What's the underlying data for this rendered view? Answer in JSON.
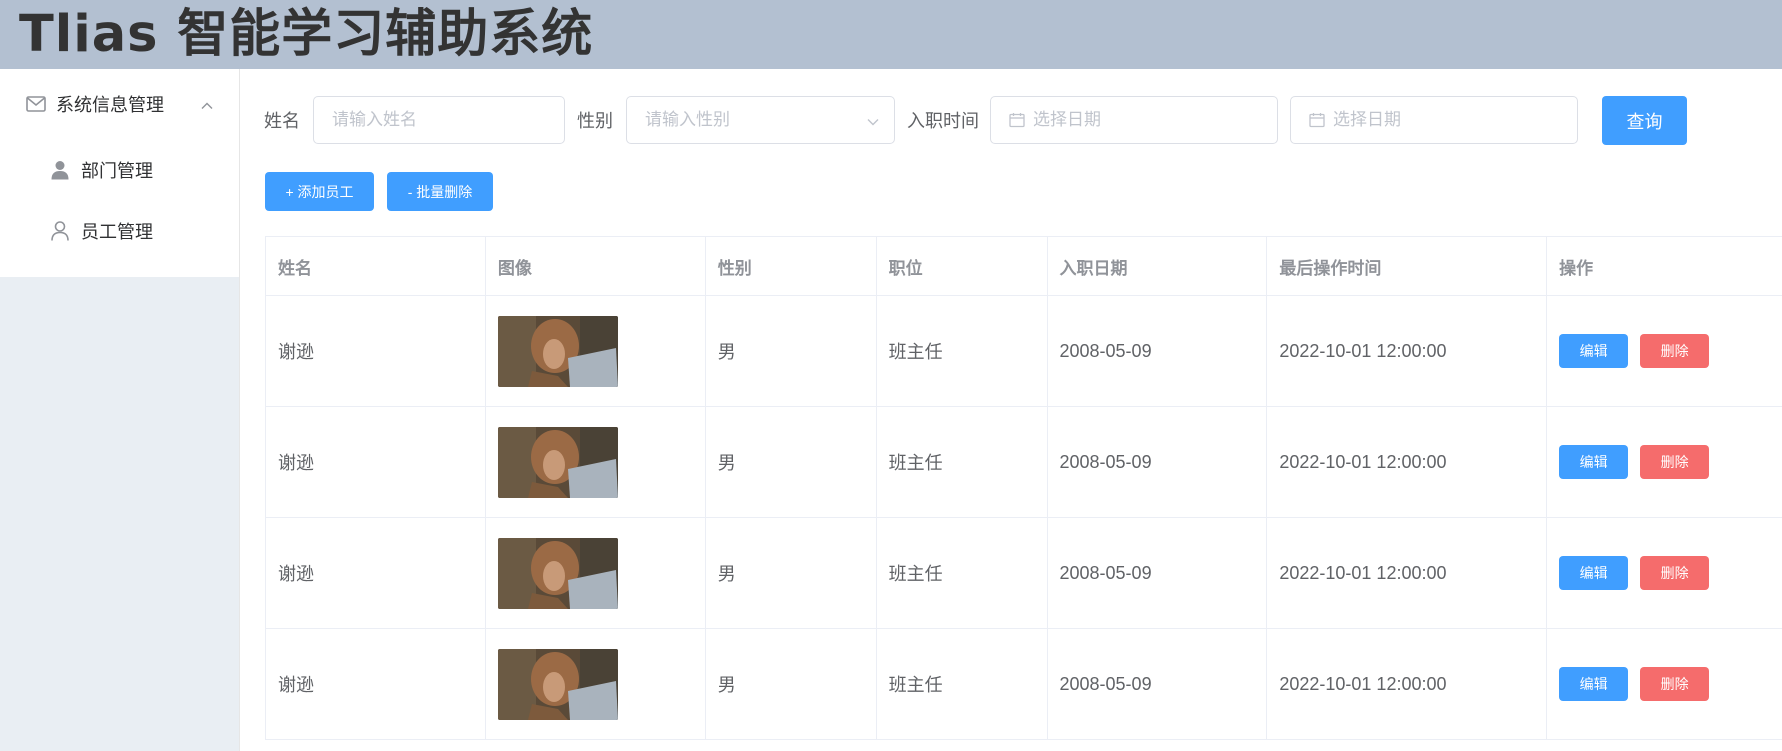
{
  "app": {
    "title": "Tlias 智能学习辅助系统"
  },
  "sidebar": {
    "group": {
      "label": "系统信息管理",
      "icon": "mail-icon",
      "expanded": true
    },
    "items": [
      {
        "label": "部门管理",
        "icon": "user-filled-icon"
      },
      {
        "label": "员工管理",
        "icon": "user-outline-icon"
      }
    ]
  },
  "search": {
    "name_label": "姓名",
    "name_placeholder": "请输入姓名",
    "name_value": "",
    "gender_label": "性别",
    "gender_placeholder": "请输入性别",
    "gender_value": "",
    "entry_label": "入职时间",
    "start_placeholder": "选择日期",
    "end_placeholder": "选择日期",
    "query_label": "查询"
  },
  "toolbar": {
    "add_label": "+ 添加员工",
    "batch_delete_label": "- 批量删除"
  },
  "colors": {
    "primary": "#409eff",
    "danger": "#f56c6c",
    "header": "#b3c0d1",
    "aside": "#e9eef3"
  },
  "table": {
    "columns": [
      "姓名",
      "图像",
      "性别",
      "职位",
      "入职日期",
      "最后操作时间",
      "操作"
    ],
    "rows": [
      {
        "name": "谢逊",
        "gender": "男",
        "job": "班主任",
        "entry_date": "2008-05-09",
        "update_time": "2022-10-01 12:00:00",
        "edit": "编辑",
        "delete": "删除"
      },
      {
        "name": "谢逊",
        "gender": "男",
        "job": "班主任",
        "entry_date": "2008-05-09",
        "update_time": "2022-10-01 12:00:00",
        "edit": "编辑",
        "delete": "删除"
      },
      {
        "name": "谢逊",
        "gender": "男",
        "job": "班主任",
        "entry_date": "2008-05-09",
        "update_time": "2022-10-01 12:00:00",
        "edit": "编辑",
        "delete": "删除"
      },
      {
        "name": "谢逊",
        "gender": "男",
        "job": "班主任",
        "entry_date": "2008-05-09",
        "update_time": "2022-10-01 12:00:00",
        "edit": "编辑",
        "delete": "删除"
      }
    ]
  }
}
